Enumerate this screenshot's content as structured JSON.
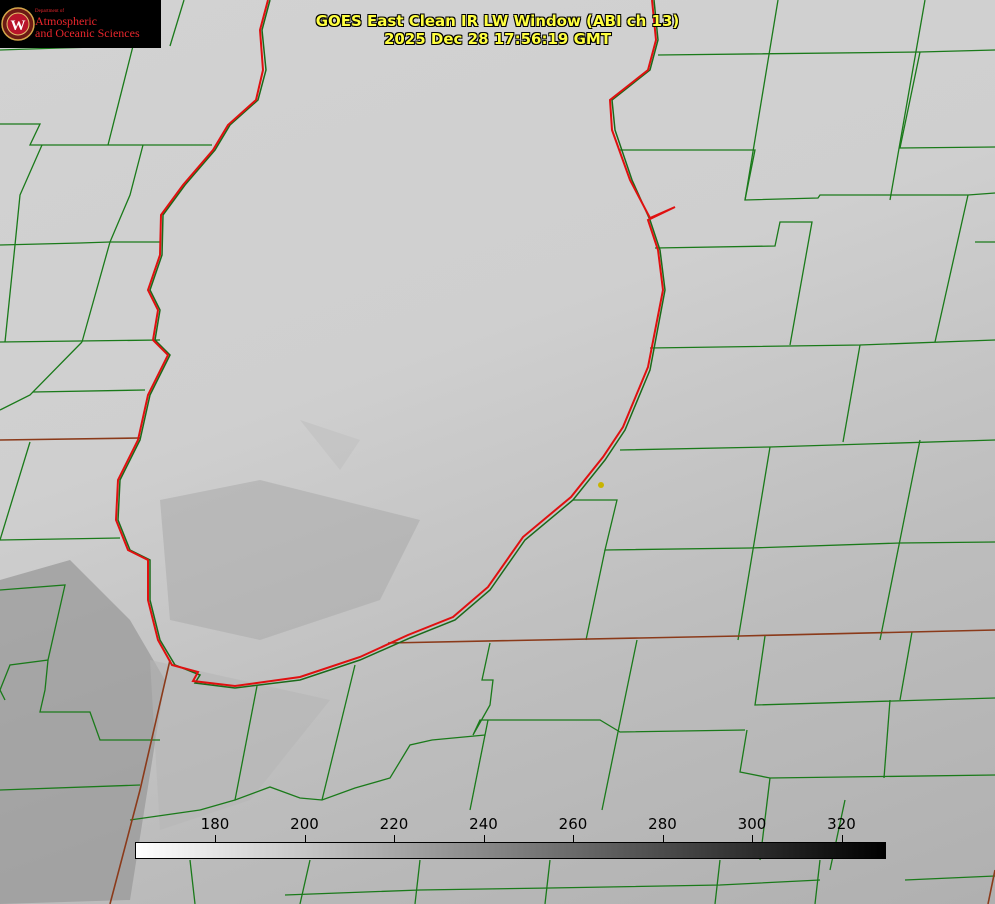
{
  "title": {
    "line1": "GOES East Clean IR LW Window (ABI ch 13)",
    "line2": "2025 Dec 28 17:56:19 GMT"
  },
  "logo": {
    "dept": "Department of",
    "line1": "Atmospheric",
    "line2": "and Oceanic Sciences",
    "seal_letter": "W"
  },
  "colorbar": {
    "ticks": [
      "180",
      "200",
      "220",
      "240",
      "260",
      "280",
      "300",
      "320"
    ],
    "gradient": [
      "#ffffff",
      "#000000"
    ]
  },
  "colors": {
    "county_lines": "#1a7a1a",
    "state_lines": "#8b3a1a",
    "lake_outline": "#e01010",
    "city_marker": "#c8b400",
    "title_text": "#ffff40"
  }
}
